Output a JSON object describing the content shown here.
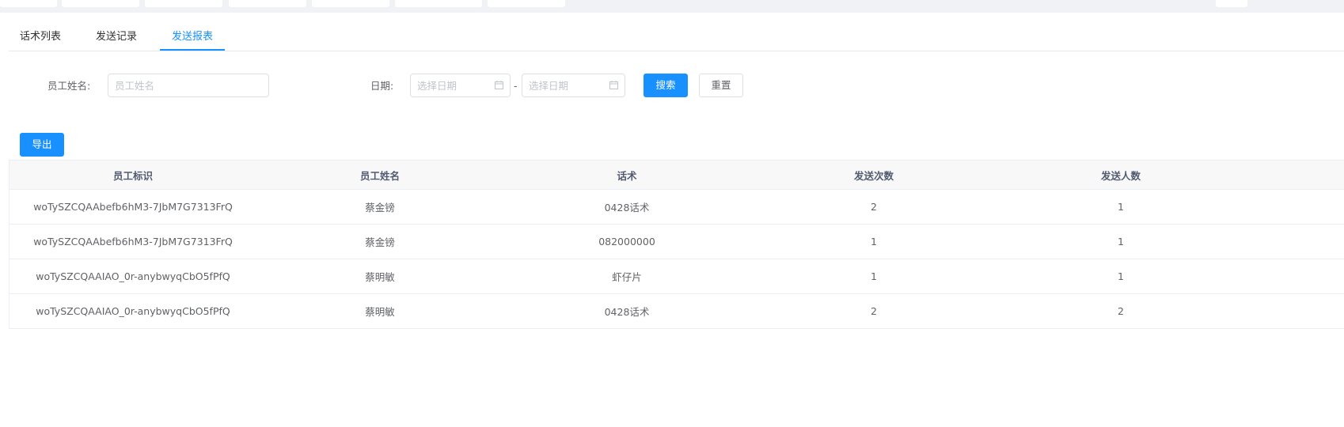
{
  "tabs": [
    {
      "label": "话术列表",
      "active": false
    },
    {
      "label": "发送记录",
      "active": false
    },
    {
      "label": "发送报表",
      "active": true
    }
  ],
  "search": {
    "employee_label": "员工姓名:",
    "employee_placeholder": "员工姓名",
    "date_label": "日期:",
    "start_placeholder": "选择日期",
    "end_placeholder": "选择日期",
    "date_separator": "-",
    "search_button": "搜索",
    "reset_button": "重置"
  },
  "toolbar": {
    "export_button": "导出"
  },
  "table": {
    "headers": [
      "员工标识",
      "员工姓名",
      "话术",
      "发送次数",
      "发送人数"
    ],
    "rows": [
      [
        "woTySZCQAAbefb6hM3-7JbM7G7313FrQ",
        "蔡金镑",
        "0428话术",
        "2",
        "1"
      ],
      [
        "woTySZCQAAbefb6hM3-7JbM7G7313FrQ",
        "蔡金镑",
        "082000000",
        "1",
        "1"
      ],
      [
        "woTySZCQAAIAO_0r-anybwyqCbO5fPfQ",
        "蔡明敏",
        "虾仔片",
        "1",
        "1"
      ],
      [
        "woTySZCQAAIAO_0r-anybwyqCbO5fPfQ",
        "蔡明敏",
        "0428话术",
        "2",
        "2"
      ]
    ]
  },
  "colors": {
    "primary": "#1890ff",
    "border": "#dcdfe6",
    "header_bg": "#f8f8f9"
  }
}
